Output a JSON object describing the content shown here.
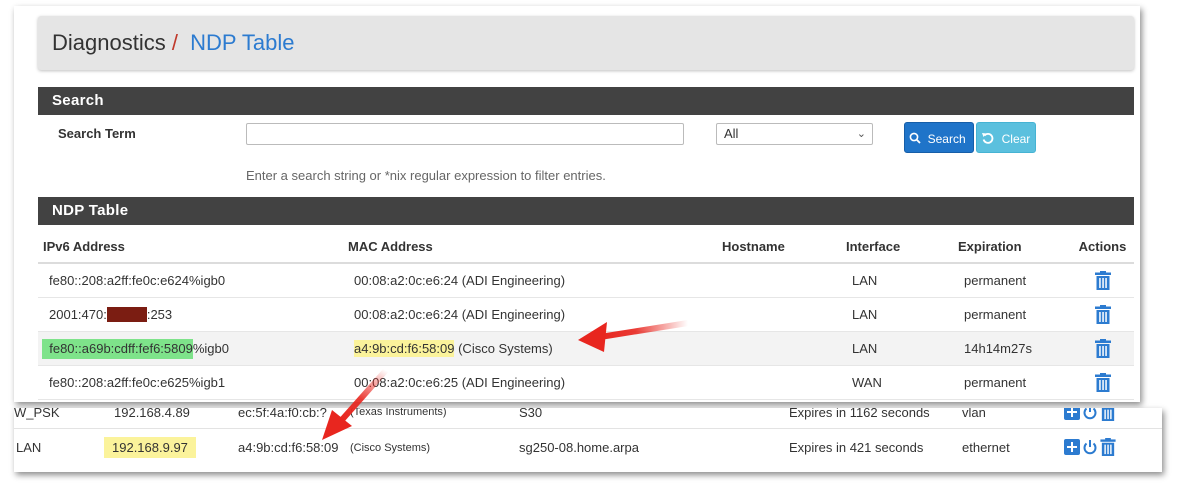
{
  "breadcrumb": {
    "root": "Diagnostics",
    "separator": "/",
    "current": "NDP Table"
  },
  "search": {
    "section_title": "Search",
    "term_label": "Search Term",
    "input_value": "",
    "select_value": "All",
    "search_button": "Search",
    "clear_button": "Clear",
    "help_text": "Enter a search string or *nix regular expression to filter entries."
  },
  "ndp": {
    "section_title": "NDP Table",
    "columns": {
      "ipv6": "IPv6 Address",
      "mac": "MAC Address",
      "hostname": "Hostname",
      "interface": "Interface",
      "expiration": "Expiration",
      "actions": "Actions"
    },
    "rows": [
      {
        "ipv6": "fe80::208:a2ff:fe0c:e624%igb0",
        "mac": "00:08:a2:0c:e6:24 (ADI Engineering)",
        "hostname": "",
        "interface": "LAN",
        "expiration": "permanent"
      },
      {
        "ipv6_prefix": "2001:470:",
        "ipv6_suffix": ":253",
        "mac": "00:08:a2:0c:e6:24 (ADI Engineering)",
        "hostname": "",
        "interface": "LAN",
        "expiration": "permanent"
      },
      {
        "ipv6_hl": "fe80::a69b:cdff:fef6:5809",
        "ipv6_rest": "%igb0",
        "mac_hl": "a4:9b:cd:f6:58:09",
        "mac_rest": " (Cisco Systems)",
        "hostname": "",
        "interface": "LAN",
        "expiration": "14h14m27s"
      },
      {
        "ipv6": "fe80::208:a2ff:fe0c:e625%igb1",
        "mac": "00:08:a2:0c:e6:25 (ADI Engineering)",
        "hostname": "",
        "interface": "WAN",
        "expiration": "permanent"
      }
    ]
  },
  "lower": {
    "partial_row": {
      "iface": "W_PSK",
      "ip": "192.168.4.89",
      "mac": "ec:5f:4a:f0:cb:?",
      "vendor": "(Texas Instruments)",
      "host": "S30",
      "expires": "Expires in 1162 seconds",
      "type": "vlan"
    },
    "row": {
      "iface": "LAN",
      "ip": "192.168.9.97",
      "mac": "a4:9b:cd:f6:58:09",
      "vendor": "(Cisco Systems)",
      "host": "sg250-08.home.arpa",
      "expires": "Expires in 421 seconds",
      "type": "ethernet"
    }
  },
  "colors": {
    "accent": "#1f74c9",
    "clear": "#5bc0de",
    "header_bar": "#424242",
    "arrow": "#e8261f",
    "trash": "#2c7bd0"
  }
}
